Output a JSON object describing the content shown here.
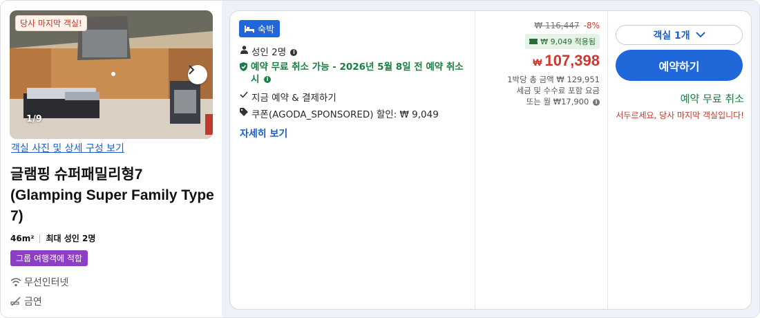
{
  "photo": {
    "badge": "당사 마지막 객실!",
    "counter": "1/9",
    "link": "객실 사진 및 상세 구성 보기"
  },
  "room": {
    "title": "글램핑 슈퍼패밀리형7 (Glamping Super Family Type 7)",
    "size": "46m²",
    "max_guests": "최대 성인 2명",
    "tag": "그룹 여행객에 적합",
    "amenities": [
      "무선인터넷",
      "금연"
    ]
  },
  "offer": {
    "stay_badge": "숙박",
    "guests": "성인 2명",
    "cancel_policy": "예약 무료 취소 가능 - 2026년 5월 8일 전 예약 취소 시",
    "pay_now": "지금 예약 & 결제하기",
    "coupon": "쿠폰(AGODA_SPONSORED) 할인: ₩ 9,049",
    "more": "자세히 보기"
  },
  "price": {
    "original": "₩ 116,447",
    "discount": "-8%",
    "coupon_applied": "₩ 9,049 적용됨",
    "currency": "₩",
    "final": "107,398",
    "note_line1": "1박당 총 금액 ₩ 129,951",
    "note_line2": "세금 및 수수료 포함 요금",
    "note_line3": "또는 월 ₩17,900"
  },
  "booking": {
    "room_select": "객실 1개",
    "book_button": "예약하기",
    "free_cancel": "예약 무료 취소",
    "hurry": "서두르세요, 당사 마지막 객실입니다!"
  },
  "colors": {
    "primary_blue": "#2067da",
    "price_red": "#d0362f",
    "green": "#188042",
    "purple_tag": "#8c3fc4"
  },
  "icons": [
    "chevron-right-icon",
    "bed-icon",
    "person-icon",
    "info-icon",
    "shield-check-icon",
    "check-icon",
    "tag-icon",
    "ticket-icon",
    "chevron-down-icon",
    "wifi-icon",
    "no-smoking-icon"
  ]
}
